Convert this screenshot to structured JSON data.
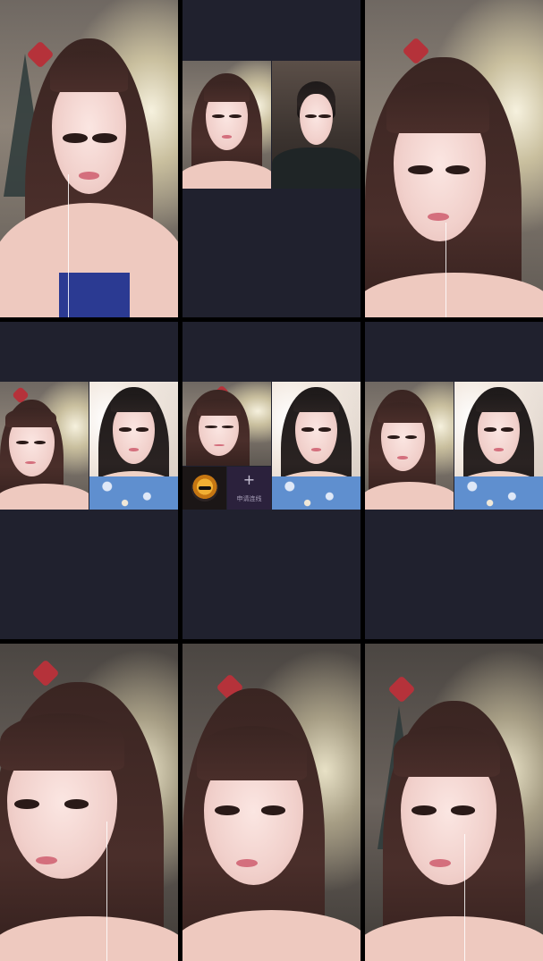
{
  "screen": {
    "background_color": "#000000",
    "panel_color": "#20212e"
  },
  "grid": {
    "cells": [
      {
        "id": "stream-1",
        "layout": "single"
      },
      {
        "id": "stream-2",
        "layout": "duo-top"
      },
      {
        "id": "stream-3",
        "layout": "single"
      },
      {
        "id": "stream-4",
        "layout": "duo-middle"
      },
      {
        "id": "stream-5",
        "layout": "guest-with-slots"
      },
      {
        "id": "stream-6",
        "layout": "duo-middle"
      },
      {
        "id": "stream-7",
        "layout": "single"
      },
      {
        "id": "stream-8",
        "layout": "single"
      },
      {
        "id": "stream-9",
        "layout": "single"
      }
    ]
  },
  "guest_slots": {
    "avatar_icon": "sunglasses-avatar-icon",
    "apply_icon": "plus-icon",
    "apply_symbol": "+",
    "apply_label": "申请连线"
  }
}
